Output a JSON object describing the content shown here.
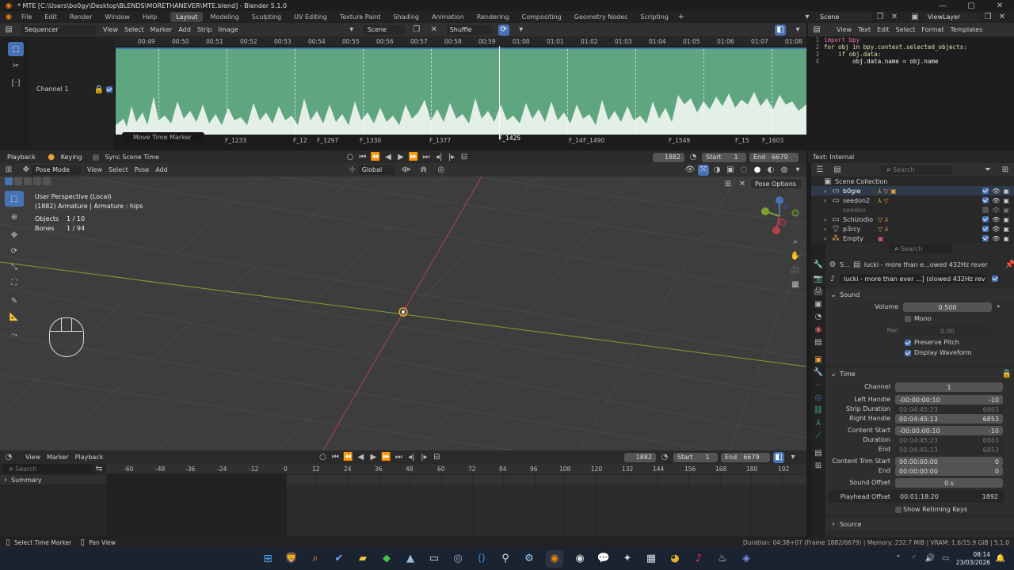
{
  "title": "* MTE [C:\\Users\\bo0gy\\Desktop\\BLENDS\\MORETHANEVER\\MTE.blend] - Blender 5.1.0",
  "menu": [
    "File",
    "Edit",
    "Render",
    "Window",
    "Help"
  ],
  "workspaces": [
    "Layout",
    "Modeling",
    "Sculpting",
    "UV Editing",
    "Texture Paint",
    "Shading",
    "Animation",
    "Rendering",
    "Compositing",
    "Geometry Nodes",
    "Scripting"
  ],
  "active_workspace": "Layout",
  "scene": "Scene",
  "view_layer": "ViewLayer",
  "sequencer": {
    "editor": "Sequencer",
    "menus": [
      "View",
      "Select",
      "Marker",
      "Add",
      "Strip",
      "Image"
    ],
    "scene": "Scene",
    "shuffle": "Shuffle",
    "channel": "Channel 1",
    "timecodes": [
      "00:49",
      "00:50",
      "00:51",
      "00:52",
      "00:53",
      "00:54",
      "00:55",
      "00:56",
      "00:57",
      "00:58",
      "00:59",
      "01:00",
      "01:01",
      "01:02",
      "01:03",
      "01:04",
      "01:05",
      "01:06",
      "01:07",
      "01:08"
    ],
    "markers": [
      "F_1233",
      "F_12",
      "F_1297",
      "F_1330",
      "F_1377",
      "F_1425",
      "F_14",
      "F_1490",
      "F_1549",
      "F_15",
      "F_1603"
    ],
    "tooltip": "Move Time Marker"
  },
  "playback": {
    "playback_label": "Playback",
    "keying_label": "Keying",
    "sync_label": "Sync Scene Time",
    "frame": "1882",
    "start_label": "Start",
    "start": "1",
    "end_label": "End",
    "end": "6679"
  },
  "text_editor": {
    "menus": [
      "View",
      "Text",
      "Edit",
      "Select",
      "Format",
      "Templates"
    ],
    "lines": [
      {
        "n": "1",
        "code": "import bpy"
      },
      {
        "n": "2",
        "code": "for obj in bpy.context.selected_objects:"
      },
      {
        "n": "3",
        "code": "    if obj.data:"
      },
      {
        "n": "4",
        "code": "        obj.data.name = obj.name"
      }
    ],
    "footer": "Text: Internal"
  },
  "viewport": {
    "mode": "Pose Mode",
    "menus": [
      "View",
      "Select",
      "Pose",
      "Add"
    ],
    "orientation": "Global",
    "overlay_label": "Pose Options",
    "info_line1": "User Perspective (Local)",
    "info_line2": "(1882) Armature | Armature : hips",
    "objects_label": "Objects",
    "objects_value": "1 / 10",
    "bones_label": "Bones",
    "bones_value": "1 / 94"
  },
  "outliner": {
    "search_placeholder": "Search",
    "root": "Scene Collection",
    "items": [
      "b0gie",
      "seedon2",
      "seedon",
      "Schizodio",
      "p3rcy",
      "Empty"
    ]
  },
  "properties": {
    "search_placeholder": "Search",
    "breadcrumb_short": "S...",
    "breadcrumb": "lucki - more than e...owed 432Hz rever",
    "strip_name": "lucki - more than ever ...] (slowed 432Hz reve",
    "sound_panel": "Sound",
    "volume_label": "Volume",
    "volume": "0.500",
    "mono_label": "Mono",
    "pan_label": "Pan",
    "pan": "0.00",
    "preserve_pitch": "Preserve Pitch",
    "display_waveform": "Display Waveform",
    "time_panel": "Time",
    "channel_label": "Channel",
    "channel": "1",
    "left_handle_label": "Left Handle",
    "left_handle_tc": "-00:00:00:10",
    "left_handle": "-10",
    "strip_duration_label": "Strip Duration",
    "strip_duration_tc": "00:04:45:23",
    "strip_duration": "6863",
    "right_handle_label": "Right Handle",
    "right_handle_tc": "00:04:45:13",
    "right_handle": "6853",
    "content_start_label": "Content Start",
    "content_start_tc": "-00:00:00:10",
    "content_start": "-10",
    "duration_label": "Duration",
    "duration_tc": "00:04:45:23",
    "duration": "6863",
    "end_label": "End",
    "end_tc": "00:04:45:13",
    "end": "6853",
    "trim_start_label": "Content Trim Start",
    "trim_start_tc": "00:00:00:00",
    "trim_start": "0",
    "trim_end_label": "End",
    "trim_end_tc": "00:00:00:00",
    "trim_end": "0",
    "sound_offset_label": "Sound Offset",
    "sound_offset": "0 s",
    "playhead_label": "Playhead Offset",
    "playhead_tc": "00:01:18:20",
    "playhead": "1892",
    "show_retiming": "Show Retiming Keys",
    "source_panel": "Source"
  },
  "timeline": {
    "menus": [
      "View",
      "Marker",
      "Playback"
    ],
    "search_placeholder": "Search",
    "summary": "Summary",
    "ticks": [
      "-60",
      "-48",
      "-36",
      "-24",
      "-12",
      "0",
      "12",
      "24",
      "36",
      "48",
      "60",
      "72",
      "84",
      "96",
      "108",
      "120",
      "132",
      "144",
      "156",
      "168",
      "180",
      "192"
    ],
    "frame": "1882",
    "start_label": "Start",
    "start": "1",
    "end_label": "End",
    "end": "6679"
  },
  "status": {
    "left1": "Select Time Marker",
    "left2": "Pan View",
    "right": "Duration: 04:38+07 (Frame 1882/6679) | Memory: 232.7 MiB | VRAM: 1.6/15.9 GiB | 5.1.0"
  },
  "taskbar": {
    "time": "08:14",
    "date": "23/03/2026"
  },
  "colors": {
    "accent": "#4772b3",
    "strip": "#5fa57f",
    "x_axis": "#b3404a",
    "y_axis": "#7ca12f"
  }
}
